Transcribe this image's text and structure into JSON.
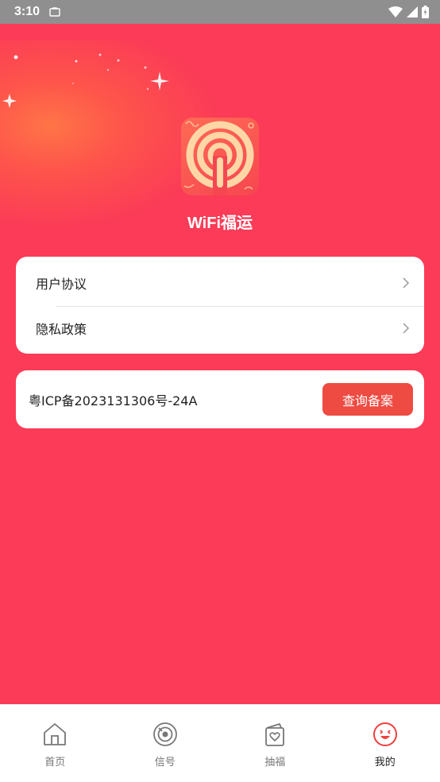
{
  "status_bar": {
    "time": "3:10",
    "icons": [
      "notification-icon",
      "wifi-icon",
      "signal-icon",
      "battery-icon"
    ]
  },
  "app": {
    "name": "WiFi福运",
    "logo_icon": "wifi-broadcast-icon"
  },
  "menu": {
    "items": [
      {
        "label": "用户协议",
        "icon": "chevron-right-icon"
      },
      {
        "label": "隐私政策",
        "icon": "chevron-right-icon"
      }
    ]
  },
  "icp": {
    "text": "粤ICP备2023131306号-24A",
    "button_label": "查询备案"
  },
  "tabbar": {
    "tabs": [
      {
        "label": "首页",
        "icon": "home-icon",
        "active": false
      },
      {
        "label": "信号",
        "icon": "signal-dial-icon",
        "active": false
      },
      {
        "label": "抽福",
        "icon": "lucky-card-icon",
        "active": false
      },
      {
        "label": "我的",
        "icon": "smiley-icon",
        "active": true
      }
    ]
  },
  "colors": {
    "background": "#fb3b57",
    "accent_button": "#ee4b43",
    "active_tab_icon": "#f0403e",
    "inactive_tab_icon": "#777777"
  }
}
